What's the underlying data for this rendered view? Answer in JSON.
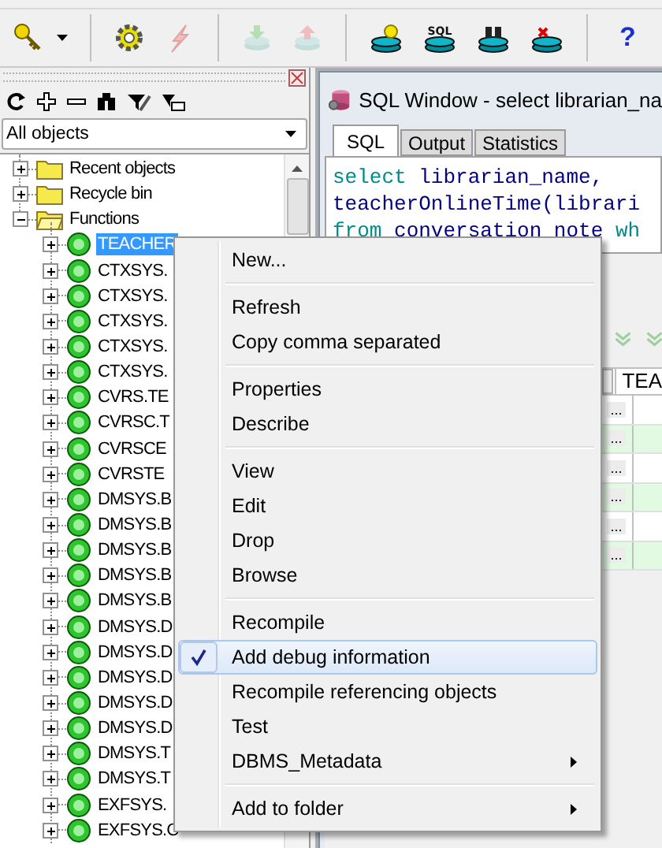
{
  "toolbar": {
    "groups": [
      [
        {
          "kind": "key",
          "disabled": false,
          "dropdown": true
        }
      ],
      [
        {
          "kind": "gear",
          "disabled": false
        },
        {
          "kind": "lightning",
          "disabled": true
        }
      ],
      [
        {
          "kind": "db-import",
          "disabled": true
        },
        {
          "kind": "db-export",
          "disabled": true
        }
      ],
      [
        {
          "kind": "db-bulb",
          "disabled": false
        },
        {
          "kind": "db-sql",
          "disabled": false,
          "label": "SQL"
        },
        {
          "kind": "db-find",
          "disabled": false
        },
        {
          "kind": "db-stop",
          "disabled": false
        }
      ],
      [
        {
          "kind": "help",
          "disabled": false,
          "label": "?"
        }
      ]
    ]
  },
  "browser": {
    "tools": [
      {
        "kind": "refresh"
      },
      {
        "kind": "add"
      },
      {
        "kind": "remove"
      },
      {
        "kind": "find"
      },
      {
        "kind": "filter"
      },
      {
        "kind": "filter-edit"
      }
    ],
    "filter": {
      "value": "All objects"
    },
    "tree": [
      {
        "label": "Recent objects",
        "kind": "folder",
        "expanded": false,
        "selected": false
      },
      {
        "label": "Recycle bin",
        "kind": "folder",
        "expanded": false,
        "selected": false
      },
      {
        "label": "Functions",
        "kind": "folder",
        "expanded": true,
        "selected": false,
        "children": [
          {
            "label": "TEACHER",
            "kind": "function",
            "expanded": false,
            "selected": true
          },
          {
            "label": "CTXSYS.",
            "kind": "function",
            "expanded": false,
            "selected": false
          },
          {
            "label": "CTXSYS.",
            "kind": "function",
            "expanded": false,
            "selected": false
          },
          {
            "label": "CTXSYS.",
            "kind": "function",
            "expanded": false,
            "selected": false
          },
          {
            "label": "CTXSYS.",
            "kind": "function",
            "expanded": false,
            "selected": false
          },
          {
            "label": "CTXSYS.",
            "kind": "function",
            "expanded": false,
            "selected": false
          },
          {
            "label": "CVRS.TE",
            "kind": "function",
            "expanded": false,
            "selected": false
          },
          {
            "label": "CVRSC.T",
            "kind": "function",
            "expanded": false,
            "selected": false
          },
          {
            "label": "CVRSCE",
            "kind": "function",
            "expanded": false,
            "selected": false
          },
          {
            "label": "CVRSTE",
            "kind": "function",
            "expanded": false,
            "selected": false
          },
          {
            "label": "DMSYS.B",
            "kind": "function",
            "expanded": false,
            "selected": false
          },
          {
            "label": "DMSYS.B",
            "kind": "function",
            "expanded": false,
            "selected": false
          },
          {
            "label": "DMSYS.B",
            "kind": "function",
            "expanded": false,
            "selected": false
          },
          {
            "label": "DMSYS.B",
            "kind": "function",
            "expanded": false,
            "selected": false
          },
          {
            "label": "DMSYS.B",
            "kind": "function",
            "expanded": false,
            "selected": false
          },
          {
            "label": "DMSYS.D",
            "kind": "function",
            "expanded": false,
            "selected": false
          },
          {
            "label": "DMSYS.D",
            "kind": "function",
            "expanded": false,
            "selected": false
          },
          {
            "label": "DMSYS.D",
            "kind": "function",
            "expanded": false,
            "selected": false
          },
          {
            "label": "DMSYS.D",
            "kind": "function",
            "expanded": false,
            "selected": false
          },
          {
            "label": "DMSYS.D",
            "kind": "function",
            "expanded": false,
            "selected": false
          },
          {
            "label": "DMSYS.T",
            "kind": "function",
            "expanded": false,
            "selected": false
          },
          {
            "label": "DMSYS.T",
            "kind": "function",
            "expanded": false,
            "selected": false
          },
          {
            "label": "EXFSYS.",
            "kind": "function",
            "expanded": false,
            "selected": false
          },
          {
            "label": "EXFSYS.C",
            "kind": "function",
            "expanded": false,
            "selected": false
          }
        ]
      }
    ]
  },
  "sql_window": {
    "title": "SQL Window - select librarian_na",
    "tabs": [
      {
        "label": "SQL",
        "selected": true
      },
      {
        "label": "Output",
        "selected": false
      },
      {
        "label": "Statistics",
        "selected": false
      }
    ],
    "code": [
      [
        {
          "text": "select",
          "kind": "keyword"
        },
        {
          "text": " librarian_name,",
          "kind": "ident"
        }
      ],
      [
        {
          "text": "teacherOnlineTime(librari",
          "kind": "ident"
        }
      ],
      [
        {
          "text": "from",
          "kind": "keyword"
        },
        {
          "text": " conversation_note ",
          "kind": "ident"
        },
        {
          "text": "wh",
          "kind": "keyword"
        }
      ]
    ],
    "results": {
      "columns": [
        "TEA"
      ],
      "rows": [
        {
          "button": "..."
        },
        {
          "button": "..."
        },
        {
          "button": "..."
        },
        {
          "button": "..."
        },
        {
          "button": "..."
        },
        {
          "button": "..."
        }
      ]
    }
  },
  "context_menu": {
    "items": [
      {
        "kind": "item",
        "label": "New...",
        "checked": false,
        "selected": false,
        "submenu": false
      },
      {
        "kind": "separator"
      },
      {
        "kind": "item",
        "label": "Refresh",
        "checked": false,
        "selected": false,
        "submenu": false
      },
      {
        "kind": "item",
        "label": "Copy comma separated",
        "checked": false,
        "selected": false,
        "submenu": false
      },
      {
        "kind": "separator"
      },
      {
        "kind": "item",
        "label": "Properties",
        "checked": false,
        "selected": false,
        "submenu": false
      },
      {
        "kind": "item",
        "label": "Describe",
        "checked": false,
        "selected": false,
        "submenu": false
      },
      {
        "kind": "separator"
      },
      {
        "kind": "item",
        "label": "View",
        "checked": false,
        "selected": false,
        "submenu": false
      },
      {
        "kind": "item",
        "label": "Edit",
        "checked": false,
        "selected": false,
        "submenu": false
      },
      {
        "kind": "item",
        "label": "Drop",
        "checked": false,
        "selected": false,
        "submenu": false
      },
      {
        "kind": "item",
        "label": "Browse",
        "checked": false,
        "selected": false,
        "submenu": false
      },
      {
        "kind": "separator"
      },
      {
        "kind": "item",
        "label": "Recompile",
        "checked": false,
        "selected": false,
        "submenu": false
      },
      {
        "kind": "item",
        "label": "Add debug information",
        "checked": true,
        "selected": true,
        "submenu": false
      },
      {
        "kind": "item",
        "label": "Recompile referencing objects",
        "checked": false,
        "selected": false,
        "submenu": false
      },
      {
        "kind": "item",
        "label": "Test",
        "checked": false,
        "selected": false,
        "submenu": false
      },
      {
        "kind": "item",
        "label": "DBMS_Metadata",
        "checked": false,
        "selected": false,
        "submenu": true
      },
      {
        "kind": "separator"
      },
      {
        "kind": "item",
        "label": "Add to folder",
        "checked": false,
        "selected": false,
        "submenu": true
      }
    ]
  }
}
